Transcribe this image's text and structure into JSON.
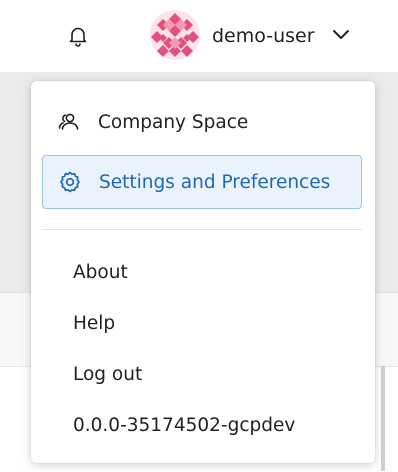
{
  "header": {
    "username": "demo-user",
    "icons": {
      "notifications": "bell-icon",
      "avatar": "identicon-avatar",
      "dropdown": "chevron-down-icon"
    }
  },
  "menu": {
    "company_space": {
      "label": "Company Space",
      "icon": "users-icon"
    },
    "settings": {
      "label": "Settings and Preferences",
      "icon": "gear-icon",
      "selected": true
    },
    "about": "About",
    "help": "Help",
    "logout": "Log out",
    "version": "0.0.0-35174502-gcpdev"
  },
  "colors": {
    "accent": "#1f69b3",
    "selected_background": "#eaf2fc",
    "selected_border": "#9cc4ec",
    "avatar": "#e2507e",
    "text": "#222222"
  }
}
